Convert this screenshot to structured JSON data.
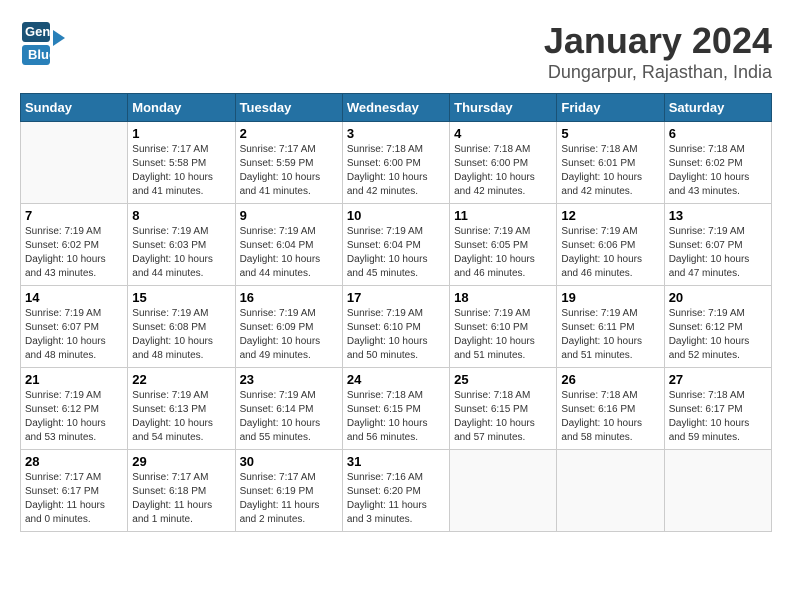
{
  "logo": {
    "line1": "General",
    "line2": "Blue"
  },
  "title": "January 2024",
  "location": "Dungarpur, Rajasthan, India",
  "weekdays": [
    "Sunday",
    "Monday",
    "Tuesday",
    "Wednesday",
    "Thursday",
    "Friday",
    "Saturday"
  ],
  "weeks": [
    [
      {
        "day": "",
        "info": ""
      },
      {
        "day": "1",
        "info": "Sunrise: 7:17 AM\nSunset: 5:58 PM\nDaylight: 10 hours\nand 41 minutes."
      },
      {
        "day": "2",
        "info": "Sunrise: 7:17 AM\nSunset: 5:59 PM\nDaylight: 10 hours\nand 41 minutes."
      },
      {
        "day": "3",
        "info": "Sunrise: 7:18 AM\nSunset: 6:00 PM\nDaylight: 10 hours\nand 42 minutes."
      },
      {
        "day": "4",
        "info": "Sunrise: 7:18 AM\nSunset: 6:00 PM\nDaylight: 10 hours\nand 42 minutes."
      },
      {
        "day": "5",
        "info": "Sunrise: 7:18 AM\nSunset: 6:01 PM\nDaylight: 10 hours\nand 42 minutes."
      },
      {
        "day": "6",
        "info": "Sunrise: 7:18 AM\nSunset: 6:02 PM\nDaylight: 10 hours\nand 43 minutes."
      }
    ],
    [
      {
        "day": "7",
        "info": "Sunrise: 7:19 AM\nSunset: 6:02 PM\nDaylight: 10 hours\nand 43 minutes."
      },
      {
        "day": "8",
        "info": "Sunrise: 7:19 AM\nSunset: 6:03 PM\nDaylight: 10 hours\nand 44 minutes."
      },
      {
        "day": "9",
        "info": "Sunrise: 7:19 AM\nSunset: 6:04 PM\nDaylight: 10 hours\nand 44 minutes."
      },
      {
        "day": "10",
        "info": "Sunrise: 7:19 AM\nSunset: 6:04 PM\nDaylight: 10 hours\nand 45 minutes."
      },
      {
        "day": "11",
        "info": "Sunrise: 7:19 AM\nSunset: 6:05 PM\nDaylight: 10 hours\nand 46 minutes."
      },
      {
        "day": "12",
        "info": "Sunrise: 7:19 AM\nSunset: 6:06 PM\nDaylight: 10 hours\nand 46 minutes."
      },
      {
        "day": "13",
        "info": "Sunrise: 7:19 AM\nSunset: 6:07 PM\nDaylight: 10 hours\nand 47 minutes."
      }
    ],
    [
      {
        "day": "14",
        "info": "Sunrise: 7:19 AM\nSunset: 6:07 PM\nDaylight: 10 hours\nand 48 minutes."
      },
      {
        "day": "15",
        "info": "Sunrise: 7:19 AM\nSunset: 6:08 PM\nDaylight: 10 hours\nand 48 minutes."
      },
      {
        "day": "16",
        "info": "Sunrise: 7:19 AM\nSunset: 6:09 PM\nDaylight: 10 hours\nand 49 minutes."
      },
      {
        "day": "17",
        "info": "Sunrise: 7:19 AM\nSunset: 6:10 PM\nDaylight: 10 hours\nand 50 minutes."
      },
      {
        "day": "18",
        "info": "Sunrise: 7:19 AM\nSunset: 6:10 PM\nDaylight: 10 hours\nand 51 minutes."
      },
      {
        "day": "19",
        "info": "Sunrise: 7:19 AM\nSunset: 6:11 PM\nDaylight: 10 hours\nand 51 minutes."
      },
      {
        "day": "20",
        "info": "Sunrise: 7:19 AM\nSunset: 6:12 PM\nDaylight: 10 hours\nand 52 minutes."
      }
    ],
    [
      {
        "day": "21",
        "info": "Sunrise: 7:19 AM\nSunset: 6:12 PM\nDaylight: 10 hours\nand 53 minutes."
      },
      {
        "day": "22",
        "info": "Sunrise: 7:19 AM\nSunset: 6:13 PM\nDaylight: 10 hours\nand 54 minutes."
      },
      {
        "day": "23",
        "info": "Sunrise: 7:19 AM\nSunset: 6:14 PM\nDaylight: 10 hours\nand 55 minutes."
      },
      {
        "day": "24",
        "info": "Sunrise: 7:18 AM\nSunset: 6:15 PM\nDaylight: 10 hours\nand 56 minutes."
      },
      {
        "day": "25",
        "info": "Sunrise: 7:18 AM\nSunset: 6:15 PM\nDaylight: 10 hours\nand 57 minutes."
      },
      {
        "day": "26",
        "info": "Sunrise: 7:18 AM\nSunset: 6:16 PM\nDaylight: 10 hours\nand 58 minutes."
      },
      {
        "day": "27",
        "info": "Sunrise: 7:18 AM\nSunset: 6:17 PM\nDaylight: 10 hours\nand 59 minutes."
      }
    ],
    [
      {
        "day": "28",
        "info": "Sunrise: 7:17 AM\nSunset: 6:17 PM\nDaylight: 11 hours\nand 0 minutes."
      },
      {
        "day": "29",
        "info": "Sunrise: 7:17 AM\nSunset: 6:18 PM\nDaylight: 11 hours\nand 1 minute."
      },
      {
        "day": "30",
        "info": "Sunrise: 7:17 AM\nSunset: 6:19 PM\nDaylight: 11 hours\nand 2 minutes."
      },
      {
        "day": "31",
        "info": "Sunrise: 7:16 AM\nSunset: 6:20 PM\nDaylight: 11 hours\nand 3 minutes."
      },
      {
        "day": "",
        "info": ""
      },
      {
        "day": "",
        "info": ""
      },
      {
        "day": "",
        "info": ""
      }
    ]
  ]
}
